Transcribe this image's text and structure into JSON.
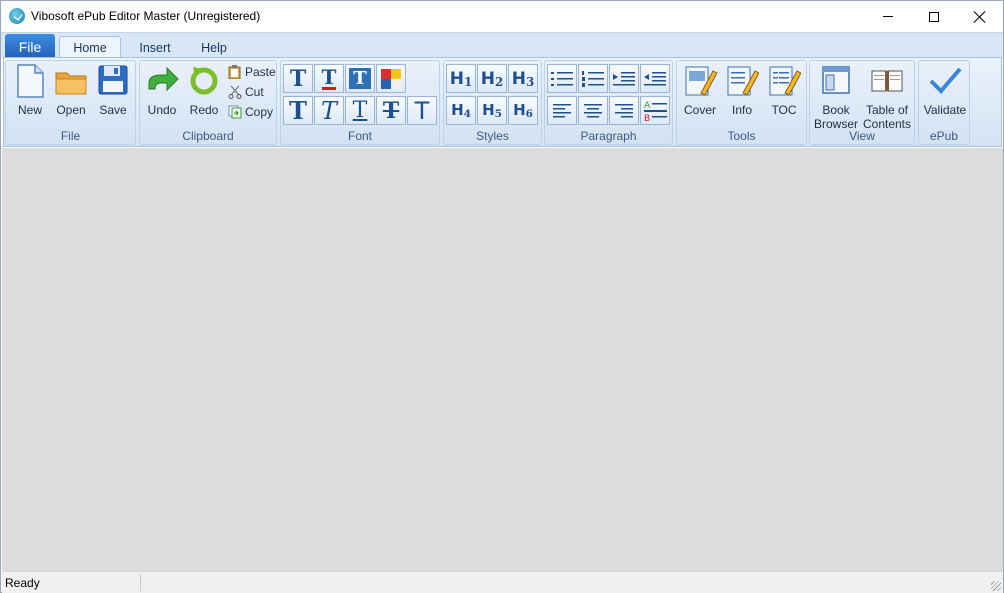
{
  "window": {
    "title": "Vibosoft ePub Editor Master (Unregistered)"
  },
  "ribbon_tabs": {
    "file": "File",
    "home": "Home",
    "insert": "Insert",
    "help": "Help"
  },
  "groups": {
    "file": {
      "label": "File",
      "new": "New",
      "open": "Open",
      "save": "Save"
    },
    "clipboard": {
      "label": "Clipboard",
      "undo": "Undo",
      "redo": "Redo",
      "paste": "Paste",
      "cut": "Cut",
      "copy": "Copy"
    },
    "font": {
      "label": "Font",
      "buttons_row1": [
        "T",
        "T",
        "T",
        "color"
      ],
      "buttons_row2": [
        "T",
        "T",
        "T",
        "T",
        "T"
      ]
    },
    "styles": {
      "label": "Styles",
      "headings": [
        "H1",
        "H2",
        "H3",
        "H4",
        "H5",
        "H6"
      ]
    },
    "paragraph": {
      "label": "Paragraph"
    },
    "tools": {
      "label": "Tools",
      "cover": "Cover",
      "info": "Info",
      "toc": "TOC"
    },
    "view": {
      "label": "View",
      "book_browser_1": "Book",
      "book_browser_2": "Browser",
      "toc_1": "Table of",
      "toc_2": "Contents"
    },
    "epub": {
      "label": "ePub",
      "validate": "Validate"
    }
  },
  "status": {
    "text": "Ready"
  },
  "colors": {
    "file_tab": "#1f5fb6",
    "ribbon_bg": "#d4e3f4",
    "content_bg": "#dcdcdc",
    "accent_text": "#1e4f8f"
  }
}
